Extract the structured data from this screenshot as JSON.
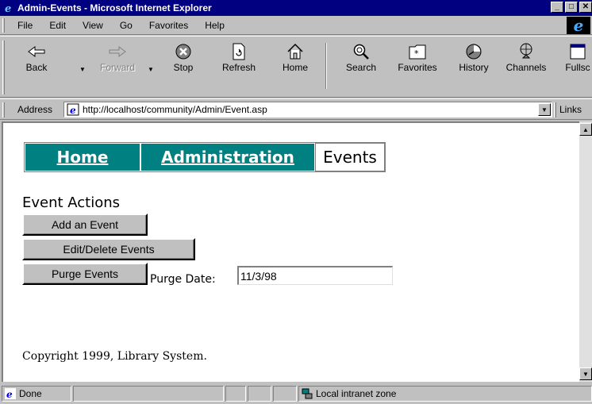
{
  "window": {
    "title": "Admin-Events - Microsoft Internet Explorer",
    "minimize_glyph": "_",
    "maximize_glyph": "□",
    "close_glyph": "✕"
  },
  "menu": {
    "items": [
      "File",
      "Edit",
      "View",
      "Go",
      "Favorites",
      "Help"
    ],
    "ie_logo": "e"
  },
  "toolbar": {
    "buttons": [
      {
        "label": "Back",
        "icon": "back-arrow-icon"
      },
      {
        "label": "Forward",
        "icon": "forward-arrow-icon"
      },
      {
        "label": "Stop",
        "icon": "stop-icon"
      },
      {
        "label": "Refresh",
        "icon": "refresh-icon"
      },
      {
        "label": "Home",
        "icon": "home-icon"
      },
      {
        "label": "Search",
        "icon": "search-icon"
      },
      {
        "label": "Favorites",
        "icon": "favorites-icon"
      },
      {
        "label": "History",
        "icon": "history-icon"
      },
      {
        "label": "Channels",
        "icon": "channels-icon"
      },
      {
        "label": "Fullsc",
        "icon": "fullscreen-icon"
      }
    ]
  },
  "address": {
    "label": "Address",
    "url": "http://localhost/community/Admin/Event.asp",
    "links_label": "Links"
  },
  "nav": {
    "home": "Home",
    "administration": "Administration",
    "events": "Events"
  },
  "main": {
    "heading": "Event Actions",
    "add_button": "Add an Event",
    "edit_button": "Edit/Delete Events",
    "purge_button": "Purge Events",
    "purge_label": "Purge Date:",
    "purge_date_value": "11/3/98",
    "copyright": "Copyright 1999, Library System."
  },
  "status": {
    "done": "Done",
    "zone": "Local intranet zone"
  },
  "colors": {
    "titlebar": "#000080",
    "nav_link_bg": "#008080",
    "chrome": "#c0c0c0"
  }
}
